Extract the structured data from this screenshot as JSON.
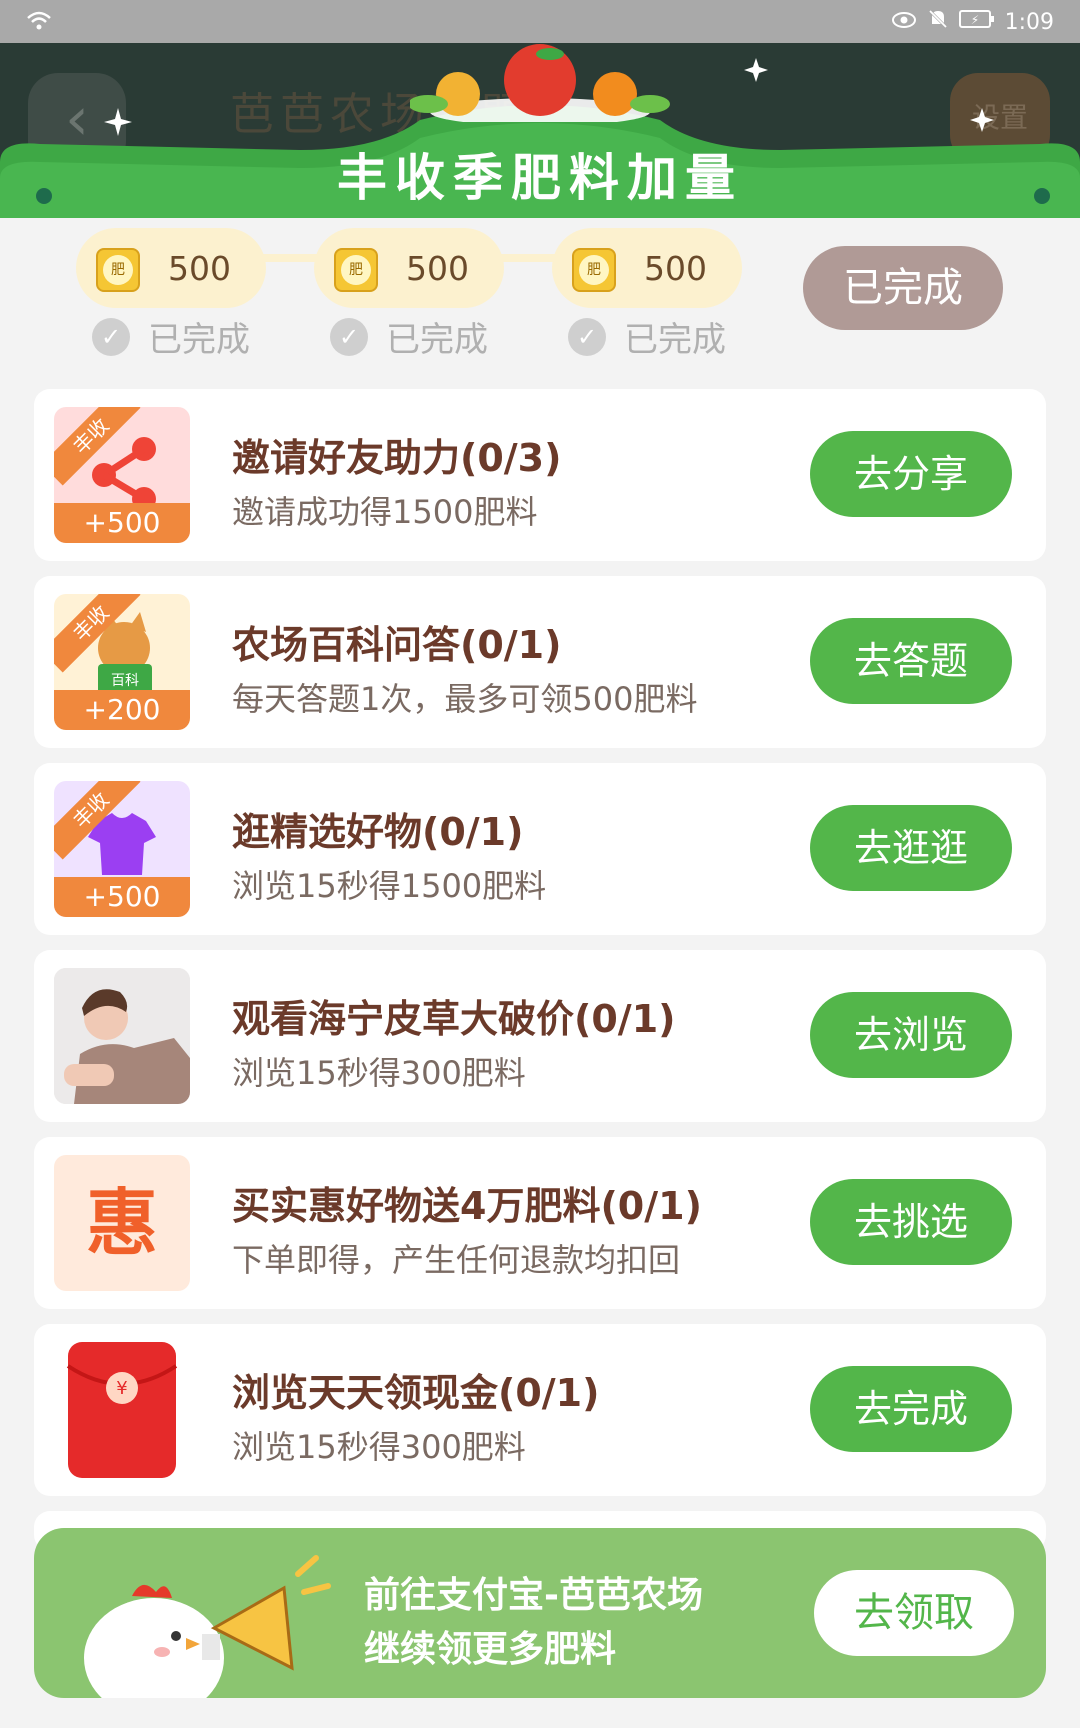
{
  "status_bar": {
    "time": "1:09",
    "battery": "⚡"
  },
  "header": {
    "title_behind": "芭芭农场问题",
    "settings_label": "设置"
  },
  "banner": {
    "title": "丰收季肥料加量"
  },
  "progress": {
    "steps": [
      {
        "value": "500",
        "status": "已完成",
        "bag_label": "肥"
      },
      {
        "value": "500",
        "status": "已完成",
        "bag_label": "肥"
      },
      {
        "value": "500",
        "status": "已完成",
        "bag_label": "肥"
      }
    ],
    "complete_button": "已完成"
  },
  "tasks": [
    {
      "title": "邀请好友助力(0/3)",
      "desc": "邀请成功得1500肥料",
      "button": "去分享",
      "badge": "丰收",
      "plus": "+500"
    },
    {
      "title": "农场百科问答(0/1)",
      "desc": "每天答题1次，最多可领500肥料",
      "button": "去答题",
      "badge": "丰收",
      "plus": "+200",
      "book_label": "百科"
    },
    {
      "title": "逛精选好物(0/1)",
      "desc": "浏览15秒得1500肥料",
      "button": "去逛逛",
      "badge": "丰收",
      "plus": "+500"
    },
    {
      "title": "观看海宁皮草大破价(0/1)",
      "desc": "浏览15秒得300肥料",
      "button": "去浏览"
    },
    {
      "title": "买实惠好物送4万肥料(0/1)",
      "desc": "下单即得，产生任何退款均扣回",
      "button": "去挑选",
      "icon_text": "惠"
    },
    {
      "title": "浏览天天领现金(0/1)",
      "desc": "浏览15秒得300肥料",
      "button": "去完成",
      "icon_text": "¥"
    }
  ],
  "footer": {
    "line1": "前往支付宝-芭芭农场",
    "line2": "继续领更多肥料",
    "button": "去领取"
  }
}
